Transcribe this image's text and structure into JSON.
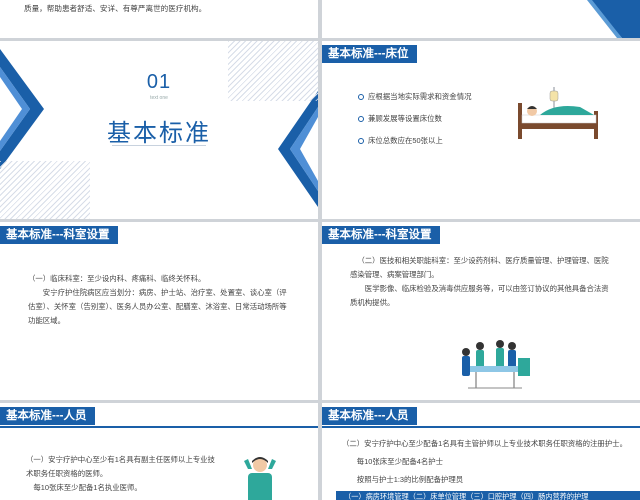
{
  "s1": {
    "text": "质量，帮助患者舒适、安详、有尊严离世的医疗机构。"
  },
  "s3": {
    "num": "01",
    "sub": "text one",
    "title": "基本标准"
  },
  "s4": {
    "header": "基本标准---床位",
    "items": [
      "应根据当地实际需求和资金情况",
      "兼顾发展等设置床位数",
      "床位总数应在50张以上"
    ]
  },
  "s5": {
    "header": "基本标准---科室设置",
    "p1": "（一）临床科室：至少设内科、疼痛科、临终关怀科。",
    "p2": "安宁疗护住院病区应当划分：病房、护士站、治疗室、处置室、谈心室（评估室）、关怀室（告别室）、医务人员办公室、配膳室、沐浴室、日常活动场所等功能区域。"
  },
  "s6": {
    "header": "基本标准---科室设置",
    "p1": "（二）医技和相关职能科室：至少设药剂科、医疗质量管理、护理管理、医院感染管理、病案管理部门。",
    "p2": "医学影像、临床检验及消毒供应服务等，可以由签订协议的其他具备合法资质机构提供。"
  },
  "s7": {
    "header": "基本标准---人员",
    "p1": "（一）安宁疗护中心至少有1名具有副主任医师以上专业技术职务任职资格的医师。",
    "p2": "每10张床至少配备1名执业医师。"
  },
  "s8": {
    "header": "基本标准---人员",
    "p1": "（二）安宁疗护中心至少配备1名具有主管护师以上专业技术职务任职资格的注册护士。",
    "p2": "每10张床至少配备4名护士",
    "p3": "按照与护士1:3的比例配备护理员",
    "bar": "（一）病房环境管理（二）床单位管理（三）口腔护理（四）肠内营养的护理"
  },
  "colors": {
    "blue": "#1a5fa8",
    "teal": "#2ea89b"
  }
}
